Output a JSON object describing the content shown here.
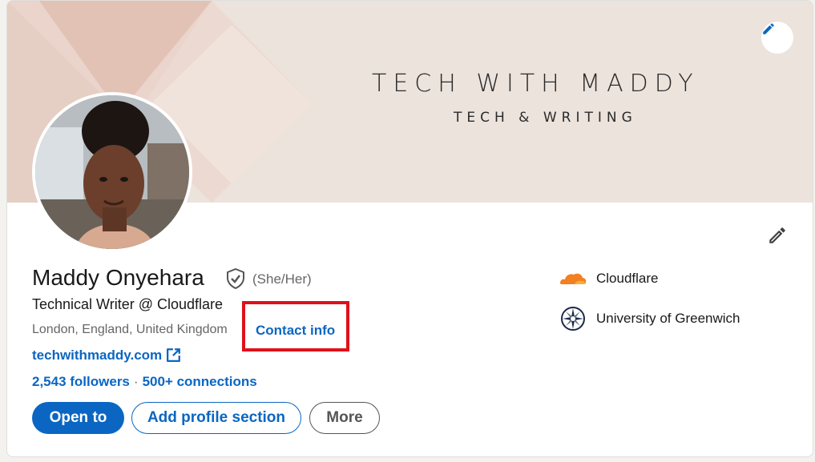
{
  "banner": {
    "title": "TECH WITH MADDY",
    "subtitle": "TECH & WRITING"
  },
  "profile": {
    "name": "Maddy Onyehara",
    "pronouns": "(She/Her)",
    "headline": "Technical Writer @ Cloudflare",
    "location": "London, England, United Kingdom",
    "contact_info_label": "Contact info",
    "website": "techwithmaddy.com",
    "followers": "2,543 followers",
    "separator": "·",
    "connections": "500+ connections"
  },
  "actions": {
    "open_to": "Open to",
    "add_section": "Add profile section",
    "more": "More"
  },
  "orgs": [
    {
      "name": "Cloudflare",
      "icon": "cloudflare-logo"
    },
    {
      "name": "University of Greenwich",
      "icon": "greenwich-logo"
    }
  ],
  "colors": {
    "link": "#0a66c2",
    "highlight": "#e0101a",
    "banner": "#ece3dc"
  }
}
